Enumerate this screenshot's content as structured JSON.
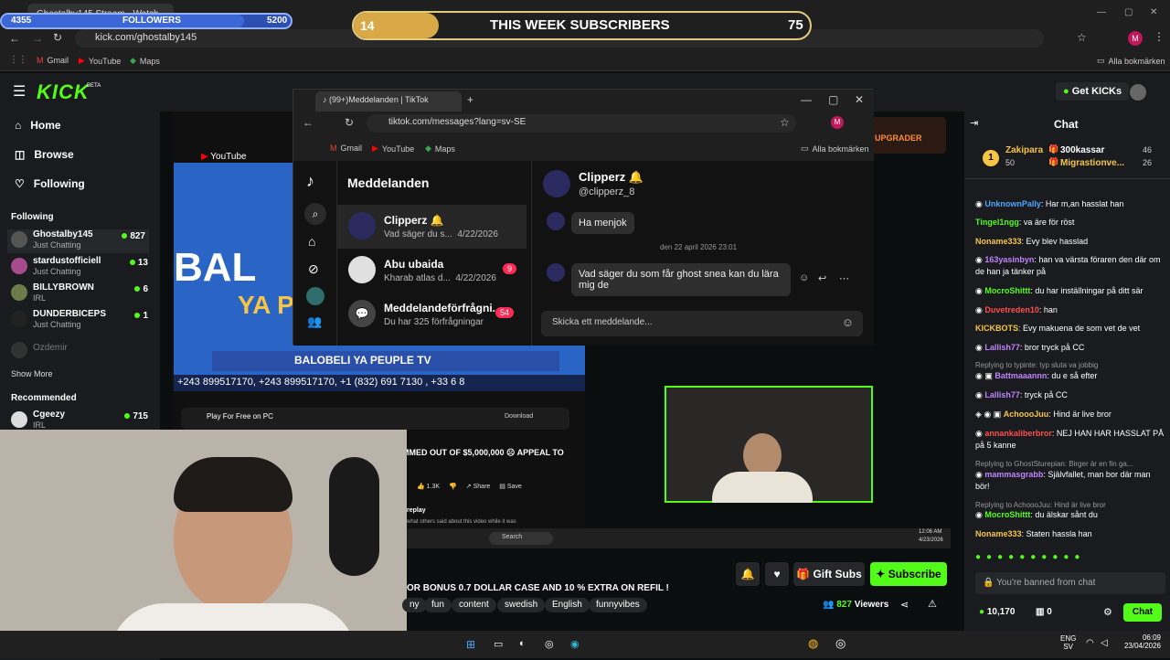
{
  "browser": {
    "tab_title": "Ghostalby145 Stream - Watch",
    "url": "kick.com/ghostalby145",
    "bookmarks": [
      "Gmail",
      "YouTube",
      "Maps"
    ],
    "all_bookmarks": "Alla bokmärken"
  },
  "overlays": {
    "followers": {
      "current": "4355",
      "label": "FOLLOWERS",
      "goal": "5200",
      "progress": 0.838
    },
    "subscribers": {
      "current": "14",
      "label": "THIS WEEK SUBSCRIBERS",
      "goal": "75",
      "progress": 0.187
    }
  },
  "kick": {
    "logo": "KICK",
    "logo_tag": "BETA",
    "get_kicks": "Get KICKs",
    "nav": [
      {
        "label": "Home"
      },
      {
        "label": "Browse"
      },
      {
        "label": "Following"
      }
    ],
    "following_heading": "Following",
    "following": [
      {
        "name": "Ghostalby145",
        "sub": "Just Chatting",
        "count": "827"
      },
      {
        "name": "stardustofficiell",
        "sub": "Just Chatting",
        "count": "13"
      },
      {
        "name": "BILLYBROWN",
        "sub": "IRL",
        "count": "6"
      },
      {
        "name": "DUNDERBICEPS",
        "sub": "Just Chatting",
        "count": "1"
      },
      {
        "name": "Ozdemir",
        "sub": "",
        "count": ""
      }
    ],
    "show_more": "Show More",
    "recommended_heading": "Recommended",
    "recommended": [
      {
        "name": "Cgeezy",
        "sub": "IRL",
        "count": "715"
      }
    ]
  },
  "tiktok": {
    "tab_title": "(99+)Meddelanden | TikTok",
    "url": "tiktok.com/messages?lang=sv-SE",
    "bookmarks": [
      "Gmail",
      "YouTube",
      "Maps"
    ],
    "all_bookmarks": "Alla bokmärken",
    "heading": "Meddelanden",
    "conversations": [
      {
        "name": "Clipperz",
        "emoji": "🔔",
        "preview": "Vad säger du s...",
        "date": "4/22/2026",
        "badge": ""
      },
      {
        "name": "Abu ubaida",
        "emoji": "",
        "preview": "Kharab atlas d...",
        "date": "4/22/2026",
        "badge": "9"
      },
      {
        "name": "Meddelandeförfrågni...",
        "emoji": "",
        "preview": "Du har 325 förfrågningar",
        "date": "",
        "badge": "54"
      }
    ],
    "chat_name": "Clipperz",
    "chat_handle": "@clipperz_8",
    "messages": [
      {
        "text": "Ha menjok"
      },
      {
        "text": "Vad säger du som får ghost snea kan du lära mig de"
      }
    ],
    "timestamp": "den 22 april 2026 23:01",
    "input_placeholder": "Skicka ett meddelande..."
  },
  "youtube": {
    "banner": "BALOBELI YA PEUPLE TV",
    "ticker": "+243 899517170, +243 899517170, +1 (832) 691 7130 , +33 6 8",
    "ad_title": "Play For Free on PC",
    "ad_button": "Download",
    "headline": "MMED OUT OF $5,000,000 ☹ APPEAL TO",
    "likes": "1.3K",
    "share": "Share",
    "save": "Save",
    "replay": "replay",
    "replay_sub": "what others said about this video while it was",
    "search_placeholder": "Search",
    "clock": "12:06 AM",
    "date": "4/23/2026"
  },
  "stream": {
    "title": "OR BONUS 0.7 DOLLAR CASE AND 10 % EXTRA ON REFIL !",
    "tags": [
      "ny",
      "fun",
      "content",
      "swedish",
      "English",
      "funnyvibes"
    ],
    "gift_subs": "Gift Subs",
    "subscribe": "Subscribe",
    "viewers_count": "827",
    "viewers_label": "Viewers",
    "upgrader": "UPGRADER"
  },
  "chat": {
    "heading": "Chat",
    "leaders": [
      {
        "name": "Zakipara",
        "value": "50"
      },
      {
        "name": "300kassar",
        "value": "46"
      },
      {
        "name": "Migrastionve...",
        "value": "26"
      }
    ],
    "messages": [
      {
        "user": "UnknownPally",
        "color": "#4aa8ff",
        "text": "Har m,an hasslat han"
      },
      {
        "user": "Tingel1ngg",
        "color": "#53fc18",
        "text": "va äre för röst"
      },
      {
        "user": "Noname333",
        "color": "#f6c544",
        "text": "Evy blev hasslad"
      },
      {
        "user": "163yasinbyn",
        "color": "#c084fc",
        "text": "han va värsta föraren den där om de han ja tänker på"
      },
      {
        "user": "MocroShittt",
        "color": "#53fc18",
        "text": "du har inställningar på ditt sär"
      },
      {
        "user": "Duvetreden10",
        "color": "#ff4d4d",
        "text": "han"
      },
      {
        "user": "KICKBOTS",
        "color": "#f6c544",
        "text": "Evy makuena de som vet de vet"
      },
      {
        "user": "Lallish77",
        "color": "#c084fc",
        "text": "bror tryck på CC"
      },
      {
        "user": "Battmaaannn",
        "color": "#c084fc",
        "text": "du e så efter",
        "reply": "Replying to typinte: typ sluta va jobbig"
      },
      {
        "user": "Lallish77",
        "color": "#c084fc",
        "text": "tryck på CC"
      },
      {
        "user": "AchoooJuu",
        "color": "#f6c544",
        "text": "Hind är live bror"
      },
      {
        "user": "annankaliberbror",
        "color": "#ff4d4d",
        "text": "NEJ HAN HAR HASSLAT PÅ på 5 kanne"
      },
      {
        "user": "mammasgrabb",
        "color": "#c084fc",
        "text": "Självfallet, man bor där man bör!",
        "reply": "Replying to GhostSturepian: Birger är en fin ga..."
      },
      {
        "user": "MocroShittt",
        "color": "#53fc18",
        "text": "du älskar sånt du",
        "reply": "Replying to AchoooJuu: Hind är live bror"
      },
      {
        "user": "Noname333",
        "color": "#f6c544",
        "text": "Staten hassla han"
      }
    ],
    "banned_placeholder": "You're banned from chat",
    "kicks_balance": "10,170",
    "other_balance": "0",
    "chat_button": "Chat"
  },
  "windows": {
    "language": "ENG",
    "region": "SV",
    "time": "06:09",
    "date": "23/04/2026"
  }
}
